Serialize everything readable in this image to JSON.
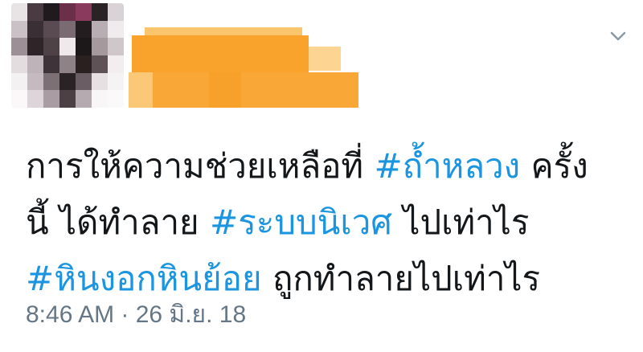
{
  "tweet": {
    "text_lines": [
      [
        {
          "text": "การให้ความช่วยเหลือที่ ",
          "hashtag": false
        },
        {
          "text": "#ถ้ำหลวง",
          "hashtag": true
        },
        {
          "text": " ครั้ง",
          "hashtag": false
        }
      ],
      [
        {
          "text": "นี้ ได้ทำลาย ",
          "hashtag": false
        },
        {
          "text": "#ระบบนิเวศ",
          "hashtag": true
        },
        {
          "text": " ไปเท่าไร",
          "hashtag": false
        }
      ],
      [
        {
          "text": "#หินงอกหินย้อย",
          "hashtag": true
        },
        {
          "text": " ถูกทำลายไปเท่าไร",
          "hashtag": false
        }
      ]
    ],
    "timestamp": "8:46 AM · 26 มิ.ย. 18"
  },
  "colors": {
    "hashtag": "#1b95e0",
    "text": "#14171a",
    "meta": "#657786",
    "redaction": "#f8a32a"
  },
  "icons": {
    "menu": "chevron-down-icon"
  }
}
